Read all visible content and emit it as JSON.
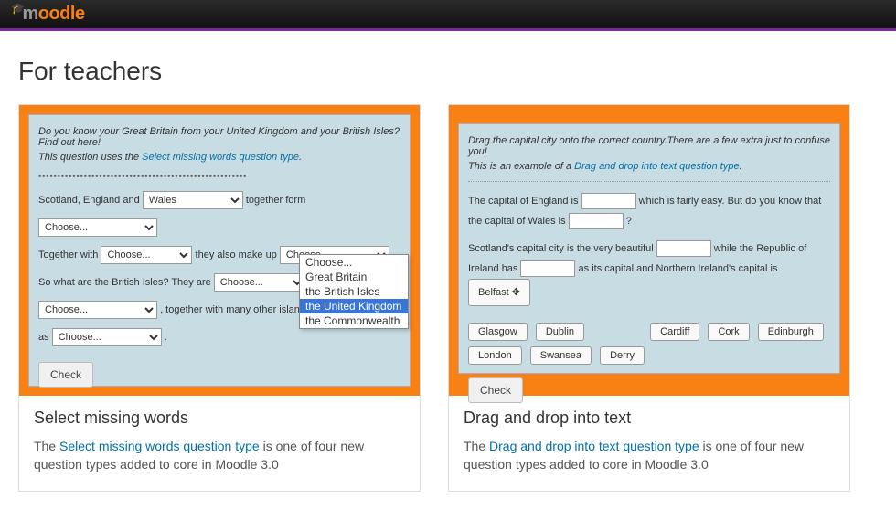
{
  "header": {
    "logo_m": "m",
    "logo_rest": "oodle"
  },
  "page": {
    "title": "For teachers"
  },
  "card1": {
    "intro1": "Do you know your Great Britain from your United Kingdom and your British Isles? Find out here!",
    "intro2_pre": "This question uses the ",
    "intro2_link": "Select missing words question type",
    "intro2_post": ".",
    "line1_pre": "Scotland, England and ",
    "line1_sel": "Wales",
    "line1_post": " together form",
    "line2_sel": "Choose...",
    "line3_pre": "Together with ",
    "line3_sel": "Choose...",
    "line3_mid": " they also make up ",
    "line3_sel2": "Choose...",
    "line4_pre": "So what are the British Isles? They are ",
    "line4_sel": "Choose...",
    "line5_sel": "Choose...",
    "line5_post": ", together with many other islands,",
    "line6_pre": "as ",
    "line6_sel": "Choose...",
    "line6_post": ".",
    "check": "Check",
    "options": [
      "Choose...",
      "Great Britain",
      "the British Isles",
      "the United Kingdom",
      "the Commonwealth"
    ],
    "card_title": "Select missing words",
    "card_desc_pre": "The ",
    "card_desc_link": "Select missing words question type",
    "card_desc_post": " is one of four new question types added to core in Moodle 3.0"
  },
  "card2": {
    "intro1": "Drag the capital city onto the correct country.There are a few extra just to confuse you!",
    "intro2_pre": "This is an example of a ",
    "intro2_link": "Drag and drop into text question type",
    "intro2_post": ".",
    "p1_a": "The capital of England is ",
    "p1_b": " which is fairly easy. But do you know that the capital of Wales is ",
    "p1_c": " ?",
    "p2_a": "Scotland's capital city is the very beautiful ",
    "p2_b": " while the Republic of Ireland has ",
    "p2_c": " as its capital and Northern Ireland's capital is ",
    "placed": "Belfast",
    "drags1": [
      "Glasgow",
      "Dublin"
    ],
    "drags2": [
      "Cardiff",
      "Cork",
      "Edinburgh"
    ],
    "drags3": [
      "London",
      "Swansea",
      "Derry"
    ],
    "check": "Check",
    "card_title": "Drag and drop into text",
    "card_desc_pre": "The ",
    "card_desc_link": "Drag and drop into text question type",
    "card_desc_post": " is one of four new question types added to core in Moodle 3.0"
  }
}
